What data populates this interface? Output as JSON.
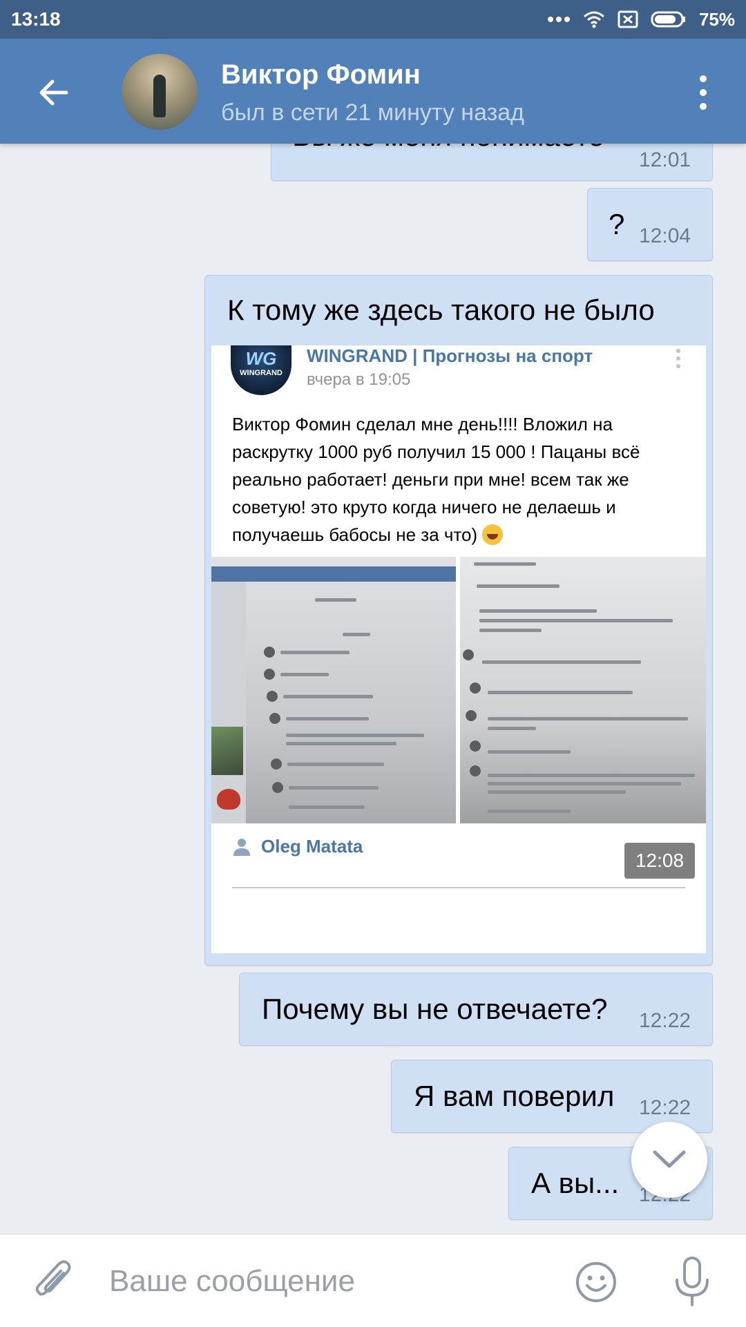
{
  "status_bar": {
    "time": "13:18",
    "battery": "75%"
  },
  "header": {
    "contact_name": "Виктор Фомин",
    "contact_status": "был в сети 21 минуту назад"
  },
  "messages": [
    {
      "text": "Вы же меня понимаете",
      "time": "12:01"
    },
    {
      "text": "?",
      "time": "12:04"
    },
    {
      "text": "К тому же здесь такого не было",
      "time": "12:08",
      "repost": {
        "group": "WINGRAND | Прогнозы на спорт",
        "logo_text": "WG",
        "logo_subtext": "WINGRAND",
        "date": "вчера в 19:05",
        "body": "Виктор Фомин сделал мне день!!!! Вложил на раскрутку 1000 руб получил 15 000 ! Пацаны всё реально работает! деньги при мне! всем так же советую! это круто когда ничего не делаешь и получаешь бабосы не за что)",
        "author": "Oleg Matata"
      }
    },
    {
      "text": "Почему вы не отвечаете?",
      "time": "12:22"
    },
    {
      "text": "Я вам поверил",
      "time": "12:22"
    },
    {
      "text": "А вы...",
      "time": "12:22"
    }
  ],
  "composer": {
    "placeholder": "Ваше сообщение"
  },
  "colors": {
    "header": "#5181b8",
    "status_bar": "#3d5f88",
    "bubble": "#cfe0f5",
    "background": "#eaedf1",
    "link": "#4a76a8"
  },
  "icons": [
    "back-arrow-icon",
    "more-vertical-icon",
    "attach-icon",
    "emoji-icon",
    "microphone-icon",
    "chevron-down-icon",
    "wifi-icon",
    "sim-icon",
    "battery-icon",
    "user-icon"
  ]
}
